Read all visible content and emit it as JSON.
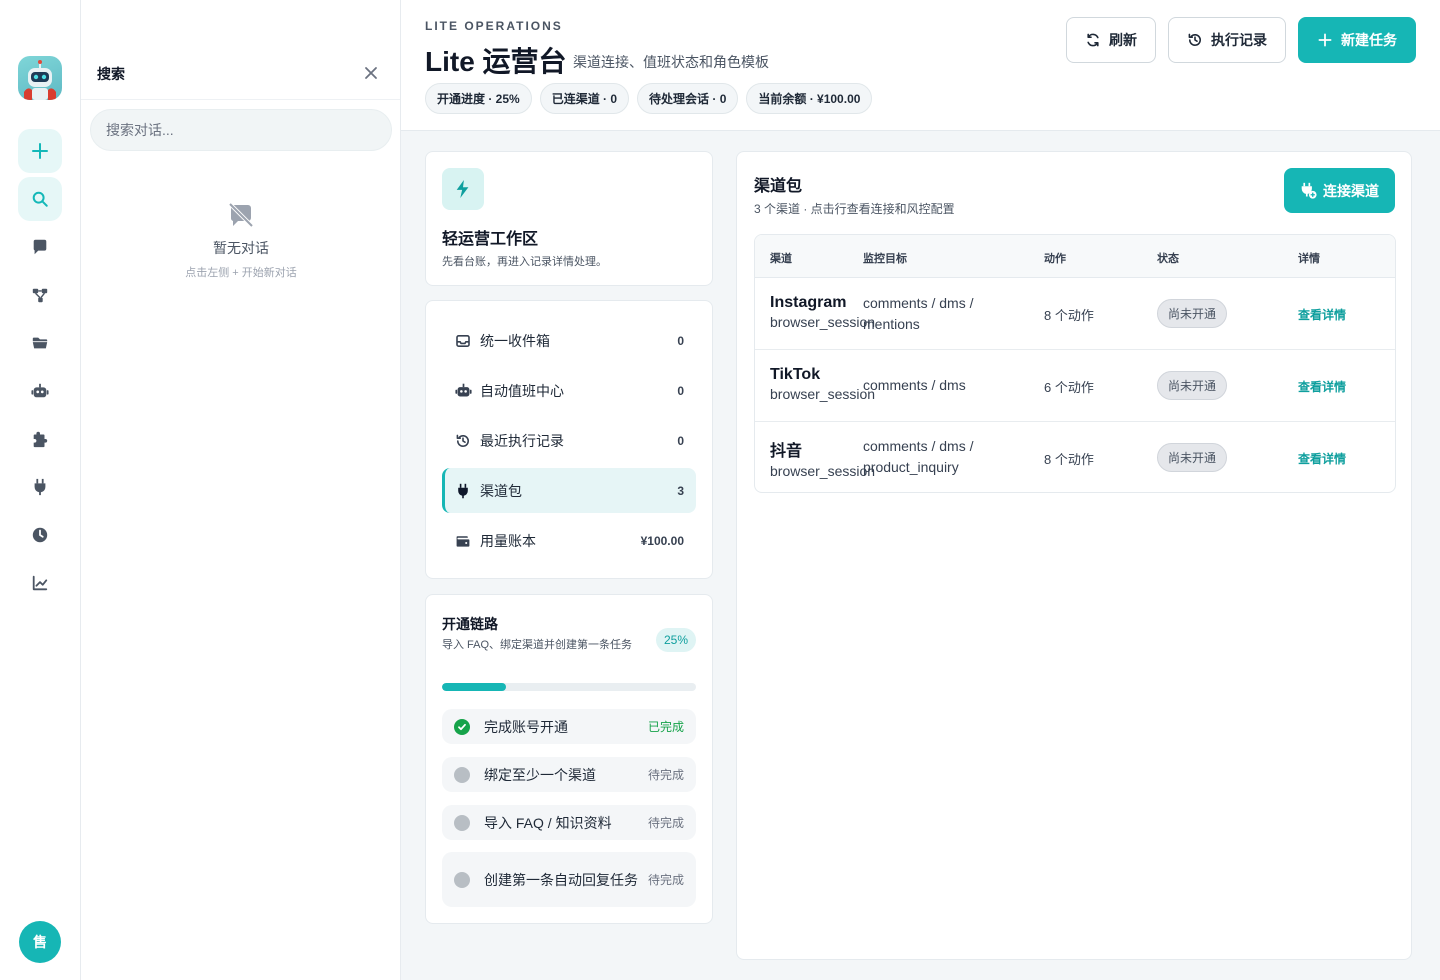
{
  "rail": {
    "avatar_text": "售",
    "items": [
      {
        "icon": "plus-icon"
      },
      {
        "icon": "search-icon"
      },
      {
        "icon": "chat-icon"
      },
      {
        "icon": "workflow-icon"
      },
      {
        "icon": "folder-icon"
      },
      {
        "icon": "robot-icon"
      },
      {
        "icon": "puzzle-icon"
      },
      {
        "icon": "plug-icon"
      },
      {
        "icon": "clock-icon"
      },
      {
        "icon": "chart-icon"
      }
    ]
  },
  "search_panel": {
    "title": "搜索",
    "placeholder": "搜索对话...",
    "empty_title": "暂无对话",
    "empty_sub": "点击左侧 + 开始新对话"
  },
  "header": {
    "eyebrow": "LITE OPERATIONS",
    "title": "Lite 运营台",
    "subtitle": "渠道连接、值班状态和角色模板",
    "chips": [
      "开通进度 · 25%",
      "已连渠道 · 0",
      "待处理会话 · 0",
      "当前余额 · ¥100.00"
    ],
    "buttons": {
      "refresh": "刷新",
      "history": "执行记录",
      "new_task": "新建任务"
    }
  },
  "workspace": {
    "title": "轻运营工作区",
    "subtitle": "先看台账，再进入记录详情处理。"
  },
  "nav": [
    {
      "label": "统一收件箱",
      "count": "0",
      "icon": "inbox-icon"
    },
    {
      "label": "自动值班中心",
      "count": "0",
      "icon": "robot-icon"
    },
    {
      "label": "最近执行记录",
      "count": "0",
      "icon": "history-icon"
    },
    {
      "label": "渠道包",
      "count": "3",
      "icon": "plug-icon",
      "active": true
    },
    {
      "label": "用量账本",
      "count": "¥100.00",
      "icon": "wallet-icon"
    }
  ],
  "onboarding": {
    "title": "开通链路",
    "subtitle": "导入 FAQ、绑定渠道并创建第一条任务",
    "percent_label": "25%",
    "progress": 0.25,
    "steps": [
      {
        "label": "完成账号开通",
        "status": "已完成",
        "done": true
      },
      {
        "label": "绑定至少一个渠道",
        "status": "待完成",
        "done": false
      },
      {
        "label": "导入 FAQ / 知识资料",
        "status": "待完成",
        "done": false
      },
      {
        "label": "创建第一条自动回复任务",
        "status": "待完成",
        "done": false
      }
    ]
  },
  "channel_pack": {
    "title": "渠道包",
    "subtitle": "3 个渠道 · 点击行查看连接和风控配置",
    "connect_button": "连接渠道",
    "columns": [
      "渠道",
      "监控目标",
      "动作",
      "状态",
      "详情"
    ],
    "rows": [
      {
        "name": "Instagram",
        "mode": "browser_session",
        "monitor": "comments / dms / mentions",
        "actions": "8 个动作",
        "status": "尚未开通",
        "link": "查看详情"
      },
      {
        "name": "TikTok",
        "mode": "browser_session",
        "monitor": "comments / dms",
        "actions": "6 个动作",
        "status": "尚未开通",
        "link": "查看详情"
      },
      {
        "name": "抖音",
        "mode": "browser_session",
        "monitor": "comments / dms / product_inquiry",
        "actions": "8 个动作",
        "status": "尚未开通",
        "link": "查看详情"
      }
    ]
  },
  "colors": {
    "accent": "#16b6b5",
    "success": "#16a34a"
  }
}
